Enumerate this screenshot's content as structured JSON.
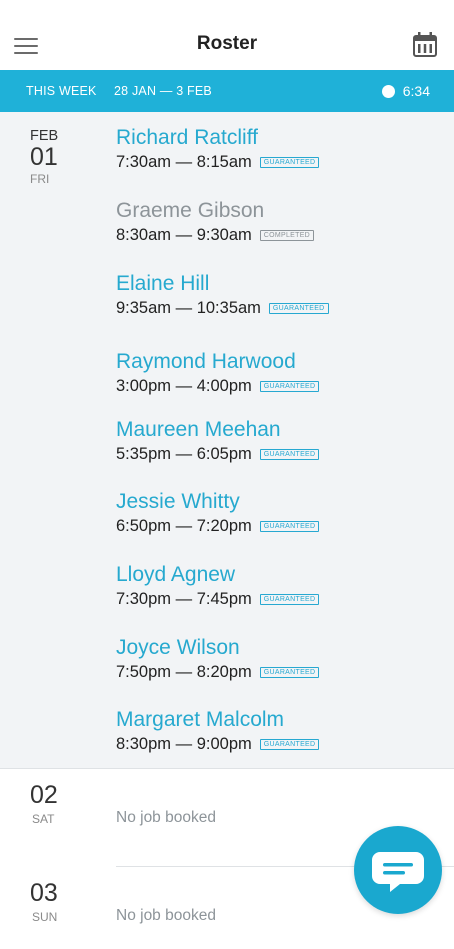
{
  "header": {
    "title": "Roster",
    "menu_icon": "hamburger-menu-icon",
    "calendar_icon": "calendar-icon"
  },
  "week_bar": {
    "label": "THIS WEEK",
    "range": "28 JAN — 3 FEB",
    "time": "6:34",
    "time_icon": "clock-icon",
    "color": "#1fb1d8"
  },
  "days": [
    {
      "month": "FEB",
      "day": "01",
      "weekday": "FRI",
      "jobs": [
        {
          "name": "Richard Ratcliff",
          "time": "7:30am — 8:15am",
          "status": "GUARANTEED"
        },
        {
          "name": "Graeme Gibson",
          "time": "8:30am — 9:30am",
          "status": "COMPLETED"
        },
        {
          "name": "Elaine Hill",
          "time": "9:35am — 10:35am",
          "status": "GUARANTEED"
        },
        {
          "name": "Raymond Harwood",
          "time": "3:00pm — 4:00pm",
          "status": "GUARANTEED"
        },
        {
          "name": "Maureen Meehan",
          "time": "5:35pm — 6:05pm",
          "status": "GUARANTEED"
        },
        {
          "name": "Jessie Whitty",
          "time": "6:50pm — 7:20pm",
          "status": "GUARANTEED"
        },
        {
          "name": "Lloyd Agnew",
          "time": "7:30pm — 7:45pm",
          "status": "GUARANTEED"
        },
        {
          "name": "Joyce Wilson",
          "time": "7:50pm — 8:20pm",
          "status": "GUARANTEED"
        },
        {
          "name": "Margaret Malcolm",
          "time": "8:30pm — 9:00pm",
          "status": "GUARANTEED"
        }
      ]
    },
    {
      "day": "02",
      "weekday": "SAT",
      "empty_text": "No job booked"
    },
    {
      "day": "03",
      "weekday": "SUN",
      "empty_text": "No job booked"
    }
  ],
  "chat_button": {
    "icon": "chat-bubble-icon",
    "color": "#1aa8cf"
  },
  "colors": {
    "accent": "#26a9cf",
    "completed": "#8d9499",
    "section_bg": "#f2f4f6"
  }
}
